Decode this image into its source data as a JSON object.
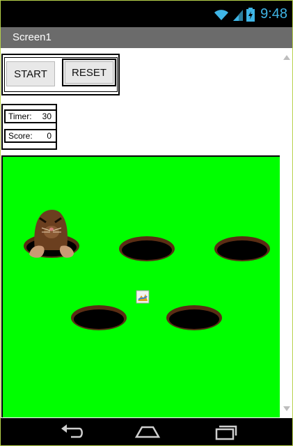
{
  "status": {
    "time": "9:48"
  },
  "app": {
    "title": "Screen1"
  },
  "controls": {
    "start_label": "START",
    "reset_label": "RESET"
  },
  "stats": {
    "timer_label": "Timer:",
    "timer_value": "30",
    "score_label": "Score:",
    "score_value": "0"
  },
  "icons": {
    "wifi": "wifi-icon",
    "signal": "signal-icon",
    "battery": "battery-icon",
    "mole": "mole-icon",
    "broken_image": "broken-image-icon",
    "back": "back-icon",
    "home": "home-icon",
    "recents": "recents-icon"
  },
  "colors": {
    "field": "#00ff00",
    "status_accent": "#3fb5e6",
    "title_bar": "#6b6b6b",
    "hole": "#5a2d14",
    "mole": "#6b3f1f"
  }
}
